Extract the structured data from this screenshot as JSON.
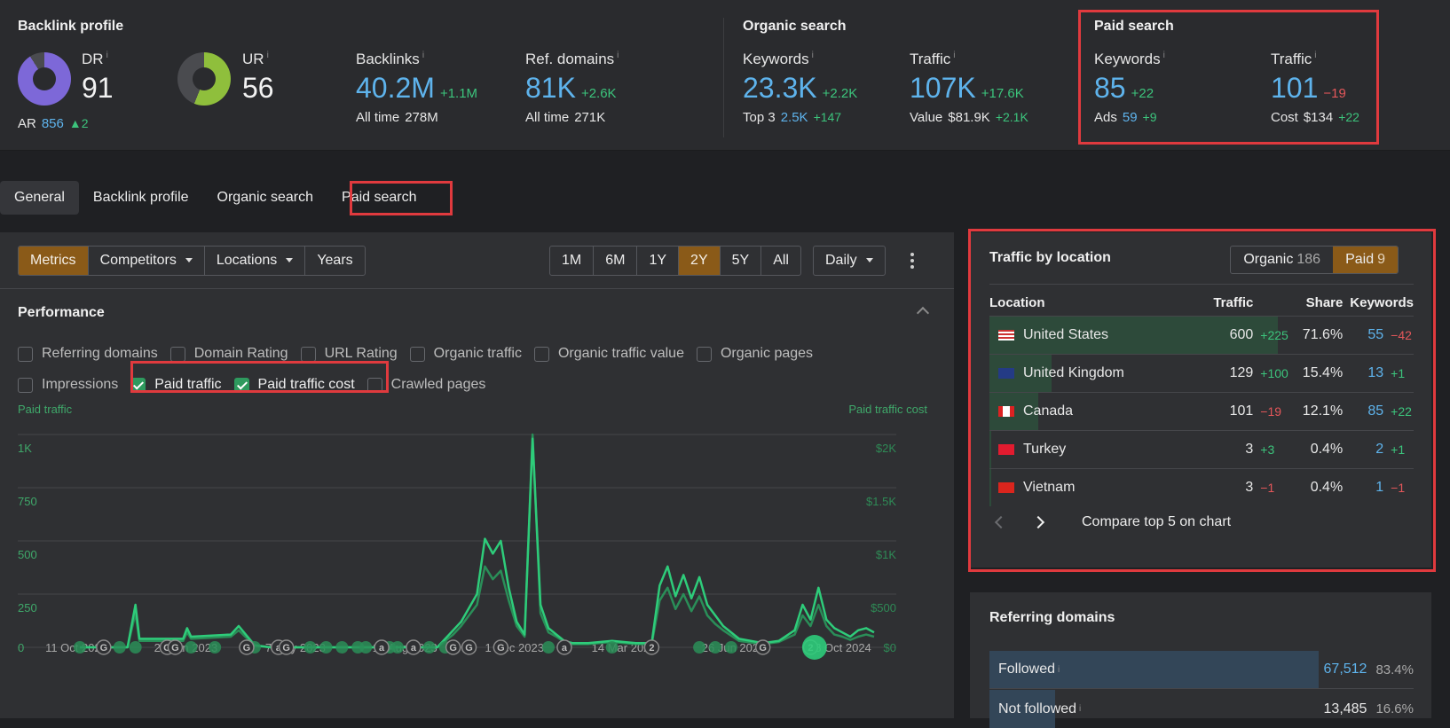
{
  "summary": {
    "backlink_profile": {
      "title": "Backlink profile",
      "dr": {
        "label": "DR",
        "value": "91",
        "fraction": 0.91,
        "color": "#7d68d8"
      },
      "ar": {
        "label": "AR",
        "value": "856",
        "delta": "▲2"
      },
      "ur": {
        "label": "UR",
        "value": "56",
        "fraction": 0.56,
        "color": "#8fbf3c"
      },
      "backlinks": {
        "label": "Backlinks",
        "value": "40.2M",
        "delta": "+1.1M",
        "sub_label": "All time",
        "sub_value": "278M"
      },
      "ref_domains": {
        "label": "Ref. domains",
        "value": "81K",
        "delta": "+2.6K",
        "sub_label": "All time",
        "sub_value": "271K"
      }
    },
    "organic_search": {
      "title": "Organic search",
      "keywords": {
        "label": "Keywords",
        "value": "23.3K",
        "delta": "+2.2K",
        "sub_label": "Top 3",
        "sub_value": "2.5K",
        "sub_delta": "+147"
      },
      "traffic": {
        "label": "Traffic",
        "value": "107K",
        "delta": "+17.6K",
        "sub_label": "Value",
        "sub_value": "$81.9K",
        "sub_delta": "+2.1K"
      }
    },
    "paid_search": {
      "title": "Paid search",
      "keywords": {
        "label": "Keywords",
        "value": "85",
        "delta": "+22",
        "sub_label": "Ads",
        "sub_value": "59",
        "sub_delta": "+9"
      },
      "traffic": {
        "label": "Traffic",
        "value": "101",
        "delta": "−19",
        "sub_label": "Cost",
        "sub_value": "$134",
        "sub_delta": "+22"
      }
    },
    "info_glyph": "i"
  },
  "tabs": [
    {
      "label": "General",
      "active": true
    },
    {
      "label": "Backlink profile"
    },
    {
      "label": "Organic search"
    },
    {
      "label": "Paid search",
      "highlighted": true
    }
  ],
  "toolbar": {
    "view_buttons": [
      "Metrics",
      "Competitors",
      "Locations",
      "Years"
    ],
    "active_view": "Metrics",
    "ranges": [
      "1M",
      "6M",
      "1Y",
      "2Y",
      "5Y",
      "All"
    ],
    "active_range": "2Y",
    "interval": "Daily",
    "more_icon": "kebab-menu-icon"
  },
  "performance": {
    "title": "Performance",
    "checkboxes_row1": [
      {
        "label": "Referring domains",
        "checked": false
      },
      {
        "label": "Domain Rating",
        "checked": false
      },
      {
        "label": "URL Rating",
        "checked": false
      },
      {
        "label": "Organic traffic",
        "checked": false
      },
      {
        "label": "Organic traffic value",
        "checked": false
      },
      {
        "label": "Organic pages",
        "checked": false
      }
    ],
    "checkboxes_row2": [
      {
        "label": "Impressions",
        "checked": false
      },
      {
        "label": "Paid traffic",
        "checked": true
      },
      {
        "label": "Paid traffic cost",
        "checked": true
      },
      {
        "label": "Crawled pages",
        "checked": false
      }
    ]
  },
  "chart_data": {
    "type": "line",
    "title": "Paid traffic / Paid traffic cost",
    "ylabel": "Paid traffic",
    "y2label": "Paid traffic cost",
    "ylim": [
      0,
      1000
    ],
    "y2lim": [
      0,
      2000
    ],
    "yticks": [
      "0",
      "250",
      "500",
      "750",
      "1K"
    ],
    "y2ticks": [
      "$0",
      "$500",
      "$1K",
      "$1.5K",
      "$2K"
    ],
    "xticks": [
      "11 Oct 2022",
      "23 Jan 2023",
      "7 May 2023",
      "19 Aug 2023",
      "1 Dec 2023",
      "14 Mar 2024",
      "26 Jun 2024",
      "8 Oct 2024"
    ],
    "grid": true,
    "x": [
      0,
      0.06,
      0.07,
      0.075,
      0.13,
      0.135,
      0.14,
      0.19,
      0.2,
      0.22,
      0.24,
      0.26,
      0.28,
      0.3,
      0.32,
      0.34,
      0.36,
      0.38,
      0.42,
      0.45,
      0.47,
      0.48,
      0.5,
      0.51,
      0.52,
      0.53,
      0.54,
      0.55,
      0.56,
      0.57,
      0.58,
      0.59,
      0.6,
      0.61,
      0.62,
      0.64,
      0.67,
      0.7,
      0.72,
      0.73,
      0.74,
      0.75,
      0.76,
      0.77,
      0.78,
      0.79,
      0.8,
      0.81,
      0.83,
      0.86,
      0.88,
      0.9,
      0.91,
      0.92,
      0.93,
      0.94,
      0.95,
      0.96,
      0.97,
      0.98,
      0.99,
      1.0
    ],
    "series": [
      {
        "name": "Paid traffic",
        "color": "#2ecc7a",
        "values": [
          0,
          0,
          200,
          40,
          40,
          90,
          50,
          60,
          100,
          10,
          0,
          0,
          0,
          0,
          0,
          0,
          0,
          0,
          0,
          0,
          80,
          120,
          250,
          510,
          440,
          500,
          280,
          120,
          60,
          980,
          200,
          90,
          60,
          30,
          20,
          20,
          30,
          20,
          20,
          290,
          380,
          240,
          340,
          230,
          330,
          200,
          150,
          100,
          40,
          20,
          30,
          80,
          200,
          130,
          280,
          130,
          90,
          70,
          50,
          80,
          90,
          70
        ]
      },
      {
        "name": "Paid traffic cost",
        "color": "#2a8e58",
        "values": [
          0,
          0,
          160,
          30,
          30,
          70,
          40,
          50,
          80,
          8,
          0,
          0,
          0,
          0,
          0,
          0,
          0,
          0,
          0,
          0,
          60,
          100,
          200,
          380,
          320,
          360,
          220,
          100,
          50,
          1000,
          160,
          70,
          50,
          25,
          15,
          15,
          25,
          15,
          15,
          220,
          280,
          180,
          250,
          170,
          240,
          150,
          110,
          80,
          30,
          15,
          25,
          60,
          150,
          100,
          200,
          100,
          60,
          50,
          35,
          50,
          60,
          50
        ]
      }
    ],
    "annotations": [
      "G",
      "G",
      "G",
      "G",
      "a",
      "G",
      "a",
      "a",
      "G",
      "G",
      "G",
      "a",
      "2",
      "G",
      "2"
    ]
  },
  "traffic_by_location": {
    "title": "Traffic by location",
    "toggle": [
      {
        "label": "Organic",
        "count": "186",
        "active": false
      },
      {
        "label": "Paid",
        "count": "9",
        "active": true
      }
    ],
    "columns": [
      "Location",
      "Traffic",
      "Share",
      "Keywords"
    ],
    "rows": [
      {
        "country": "United States",
        "flag": "us",
        "traffic": "600",
        "traffic_delta": "+225",
        "traffic_delta_sign": "pos",
        "share": "71.6%",
        "share_fraction": 0.716,
        "keywords": "55",
        "keywords_delta": "−42",
        "keywords_delta_sign": "neg"
      },
      {
        "country": "United Kingdom",
        "flag": "gb",
        "traffic": "129",
        "traffic_delta": "+100",
        "traffic_delta_sign": "pos",
        "share": "15.4%",
        "share_fraction": 0.154,
        "keywords": "13",
        "keywords_delta": "+1",
        "keywords_delta_sign": "pos"
      },
      {
        "country": "Canada",
        "flag": "ca",
        "traffic": "101",
        "traffic_delta": "−19",
        "traffic_delta_sign": "neg",
        "share": "12.1%",
        "share_fraction": 0.121,
        "keywords": "85",
        "keywords_delta": "+22",
        "keywords_delta_sign": "pos"
      },
      {
        "country": "Turkey",
        "flag": "tr",
        "traffic": "3",
        "traffic_delta": "+3",
        "traffic_delta_sign": "pos",
        "share": "0.4%",
        "share_fraction": 0.004,
        "keywords": "2",
        "keywords_delta": "+1",
        "keywords_delta_sign": "pos"
      },
      {
        "country": "Vietnam",
        "flag": "vn",
        "traffic": "3",
        "traffic_delta": "−1",
        "traffic_delta_sign": "neg",
        "share": "0.4%",
        "share_fraction": 0.004,
        "keywords": "1",
        "keywords_delta": "−1",
        "keywords_delta_sign": "neg"
      }
    ],
    "compare_label": "Compare top 5 on chart"
  },
  "referring_domains": {
    "title": "Referring domains",
    "rows": [
      {
        "label": "Followed",
        "value": "67,512",
        "share": "83.4%",
        "fraction": 0.834
      },
      {
        "label": "Not followed",
        "value": "13,485",
        "share": "16.6%",
        "fraction": 0.166
      }
    ]
  }
}
